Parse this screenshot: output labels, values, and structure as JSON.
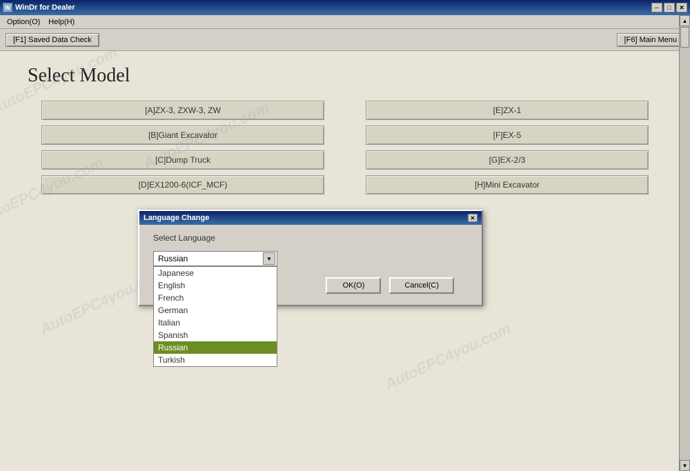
{
  "window": {
    "title": "WinDr for Dealer",
    "icon_label": "W"
  },
  "titlebar_controls": {
    "minimize": "─",
    "maximize": "□",
    "close": "✕"
  },
  "menubar": {
    "items": [
      {
        "label": "Option(O)"
      },
      {
        "label": "Help(H)"
      }
    ]
  },
  "toolbar": {
    "saved_data_btn": "[F1] Saved Data Check",
    "main_menu_btn": "[F6] Main Menu"
  },
  "main": {
    "page_title": "Select Model",
    "model_buttons": [
      {
        "id": "A",
        "label": "[A]ZX-3, ZXW-3, ZW"
      },
      {
        "id": "E",
        "label": "[E]ZX-1"
      },
      {
        "id": "B",
        "label": "[B]Giant Excavator"
      },
      {
        "id": "F",
        "label": "[F]EX-5"
      },
      {
        "id": "C",
        "label": "[C]Dump Truck"
      },
      {
        "id": "G",
        "label": "[G]EX-2/3"
      },
      {
        "id": "D",
        "label": "[D]EX1200-6(ICF_MCF)"
      },
      {
        "id": "H",
        "label": "[H]Mini Excavator"
      }
    ]
  },
  "dialog": {
    "title": "Language Change",
    "label": "Select Language",
    "current_value": "Russian",
    "ok_label": "OK(O)",
    "cancel_label": "Cancel(C)",
    "languages": [
      {
        "value": "Japanese",
        "label": "Japanese"
      },
      {
        "value": "English",
        "label": "English"
      },
      {
        "value": "French",
        "label": "French"
      },
      {
        "value": "German",
        "label": "German"
      },
      {
        "value": "Italian",
        "label": "Italian"
      },
      {
        "value": "Spanish",
        "label": "Spanish"
      },
      {
        "value": "Russian",
        "label": "Russian",
        "selected": true
      },
      {
        "value": "Turkish",
        "label": "Turkish"
      }
    ]
  },
  "watermarks": [
    "AutoEPC4you.com",
    "AutoEPC4you.com",
    "AutoEPC4you.com",
    "AutoEPC4you.com",
    "AutoEPC4you.com",
    "AutoEPC4you.com"
  ]
}
